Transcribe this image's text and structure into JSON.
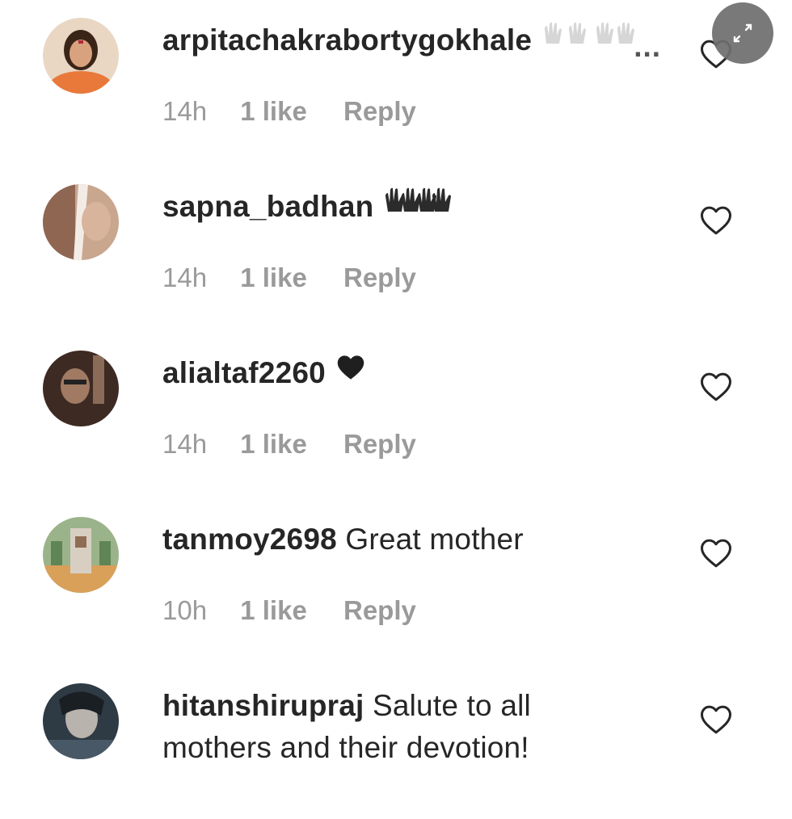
{
  "comments": [
    {
      "username": "arpitachakrabortygokhale",
      "text": "",
      "emoji": "raised-hands-emoji-faded",
      "truncated": true,
      "ellipsis": "...",
      "time": "14h",
      "likes": "1 like",
      "reply": "Reply"
    },
    {
      "username": "sapna_badhan",
      "text": "",
      "emoji": "raised-hands-emoji",
      "time": "14h",
      "likes": "1 like",
      "reply": "Reply"
    },
    {
      "username": "alialtaf2260",
      "text": "",
      "emoji": "black-heart-emoji",
      "time": "14h",
      "likes": "1 like",
      "reply": "Reply"
    },
    {
      "username": "tanmoy2698",
      "text": "Great mother",
      "time": "10h",
      "likes": "1 like",
      "reply": "Reply"
    },
    {
      "username": "hitanshirupraj",
      "text": "Salute to all mothers and their devotion!",
      "time": "",
      "likes": "",
      "reply": ""
    }
  ],
  "icons": {
    "like": "heart-outline-icon",
    "expand": "expand-arrows-icon"
  },
  "colors": {
    "text": "#262626",
    "meta": "#9a9a9a",
    "expand_bg": "#6e6e6e"
  }
}
